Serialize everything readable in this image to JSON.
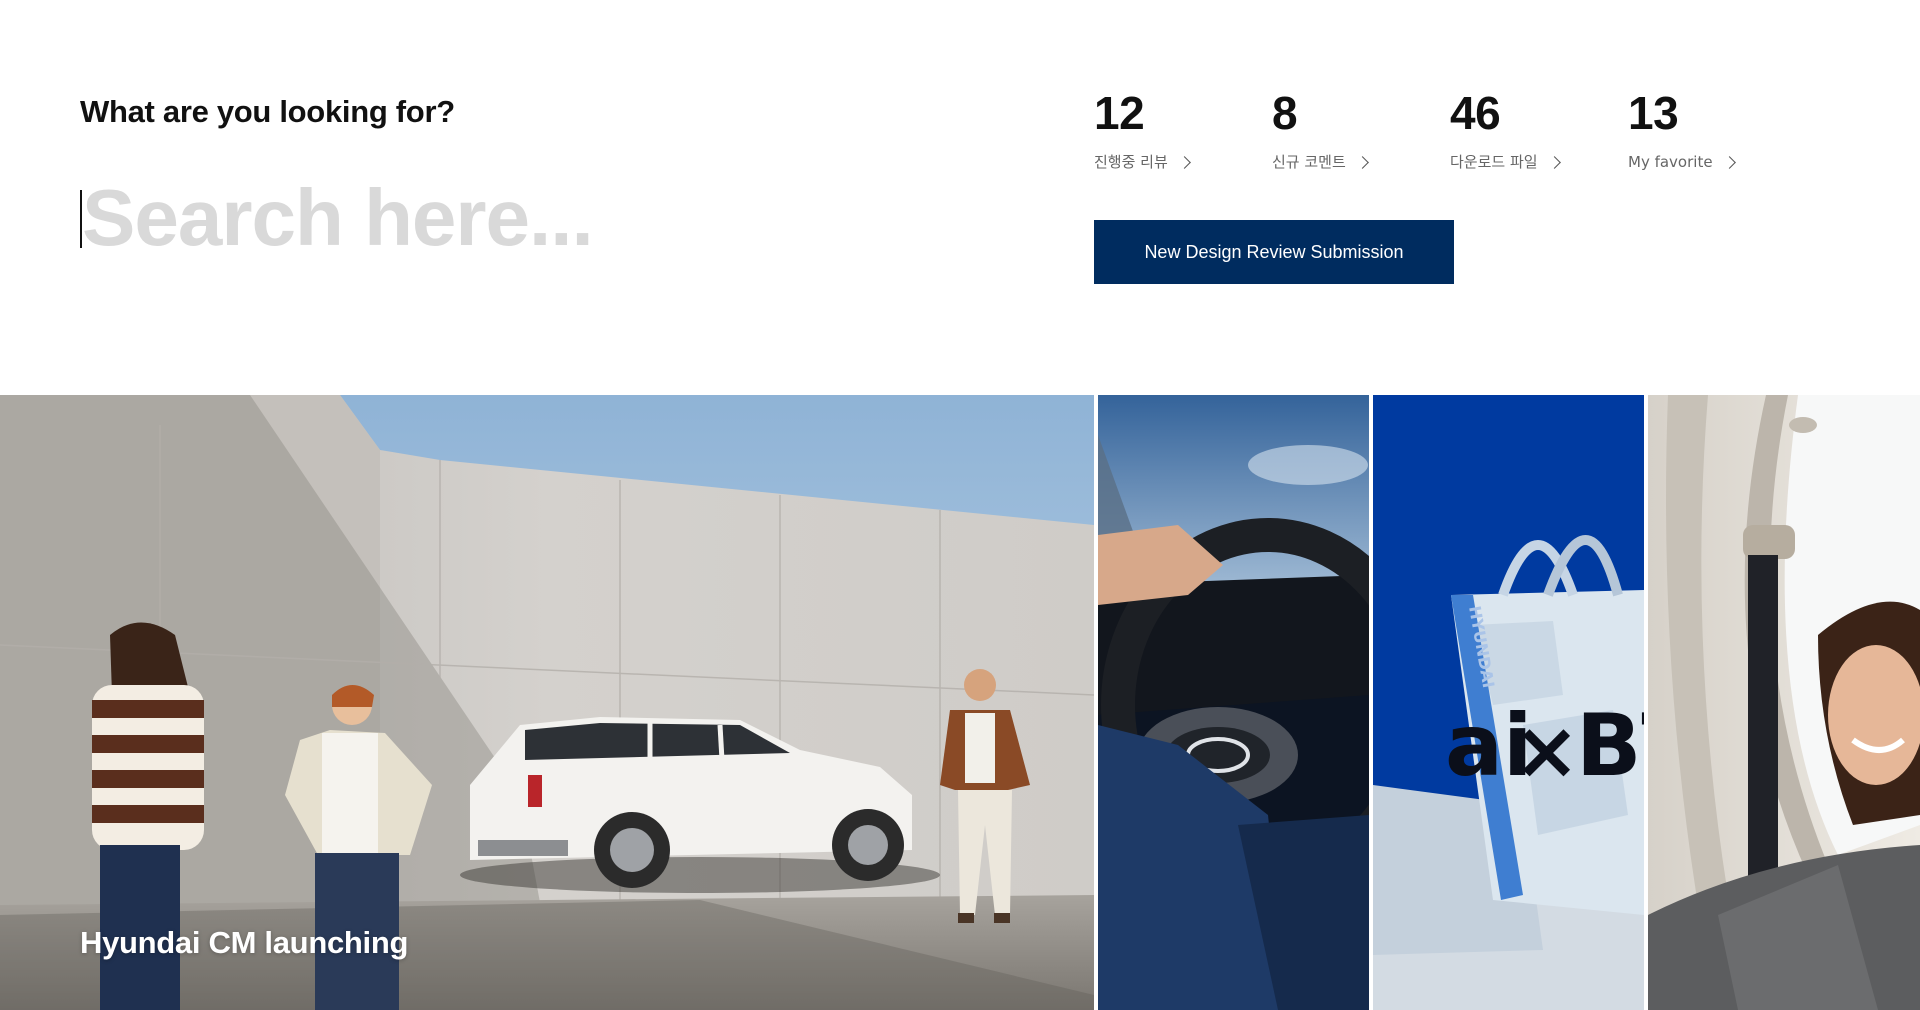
{
  "search": {
    "heading": "What are you looking for?",
    "placeholder": "Search here..."
  },
  "stats": [
    {
      "value": "12",
      "label": "진행중 리뷰"
    },
    {
      "value": "8",
      "label": "신규 코멘트"
    },
    {
      "value": "46",
      "label": "다운로드 파일"
    },
    {
      "value": "13",
      "label": "My favorite"
    }
  ],
  "cta": {
    "label": "New Design Review Submission"
  },
  "gallery": {
    "main_title": "Hyundai CM launching",
    "bag_text": "BT",
    "bag_partial": "ai",
    "bag_x": "×",
    "strap_text": "HYUNDAI"
  },
  "colors": {
    "primary": "#002c5f",
    "bag_blue": "#003aa0",
    "placeholder": "#d9d9d9"
  },
  "icons": {
    "stat_arrow": "chevron-right-icon"
  }
}
